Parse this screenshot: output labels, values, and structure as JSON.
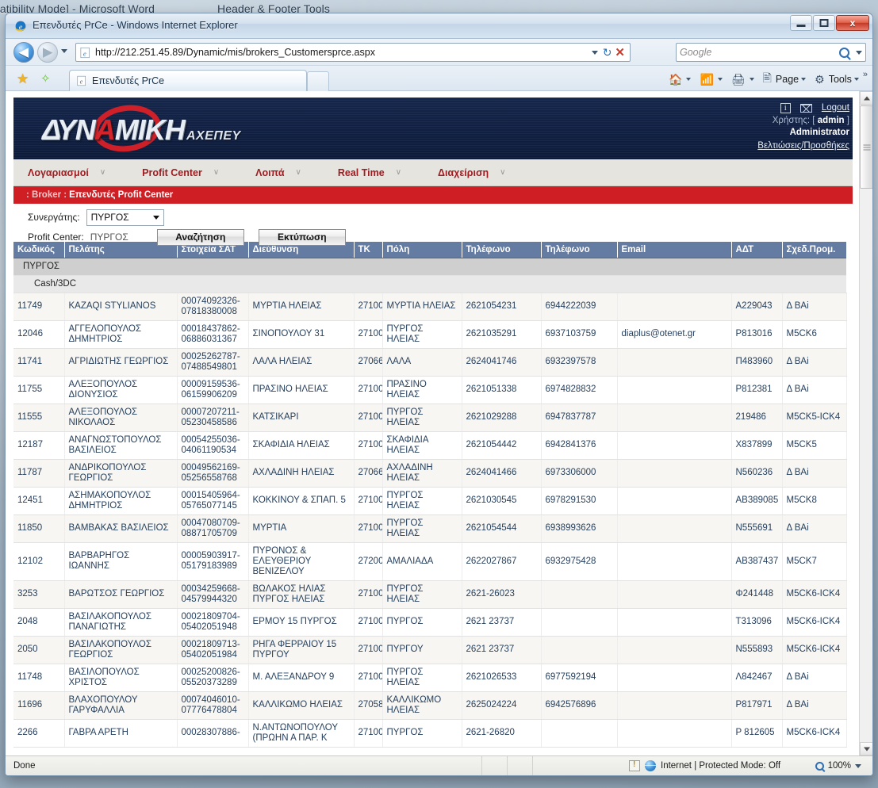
{
  "desktop": {
    "word_title": "patibility Mode] - Microsoft Word",
    "word_tools": "Header & Footer Tools"
  },
  "window": {
    "title": "Επενδυτές PrCe - Windows Internet Explorer",
    "minimize_label": "Minimize",
    "maximize_label": "Maximize",
    "close_label": "x"
  },
  "browser": {
    "back_label": "◀",
    "forward_label": "▶",
    "url": "http://212.251.45.89/Dynamic/mis/brokers_Customersprce.aspx",
    "refresh_label": "↻",
    "stop_label": "✕",
    "search_placeholder": "Google",
    "favorites_label": "Favorites",
    "add_favorite_label": "Add to Favorites",
    "tab_label": "Επενδυτές PrCe",
    "new_tab_label": "",
    "command_home": "Home",
    "command_feeds": "Feeds",
    "command_print": "Print",
    "command_page": "Page",
    "command_tools": "Tools",
    "command_more": "»"
  },
  "site": {
    "logo_main_1": "ΔΥΝ",
    "logo_main_red": "Α",
    "logo_main_2": "ΜΙΚΗ",
    "logo_sub": "ΑΧΕΠΕΥ",
    "info_icon_label": "i",
    "logout_label": "Logout",
    "user_prefix": "Χρήστης: [",
    "user_name": "admin",
    "user_suffix": "]",
    "role": "Administrator",
    "improvements_link": "Βελτιώσεις/Προσθήκες"
  },
  "navmenu": {
    "items": [
      {
        "label": "Λογαριασμοί",
        "caret": "∨"
      },
      {
        "label": "Profit Center",
        "caret": "∨"
      },
      {
        "label": "Λοιπά",
        "caret": "∨"
      },
      {
        "label": "Real Time",
        "caret": "∨"
      },
      {
        "label": "Διαχείριση",
        "caret": "∨"
      }
    ]
  },
  "breadcrumb": {
    "prefix": ": Broker :",
    "current": "Επενδυτές Profit Center"
  },
  "filters": {
    "partner_label": "Συνεργάτης:",
    "partner_value": "ΠΥΡΓΟΣ",
    "profit_center_label": "Profit Center:",
    "profit_center_value": "ΠΥΡΓΟΣ",
    "search_button": "Αναζήτηση",
    "print_button": "Εκτύπωση"
  },
  "table": {
    "columns": [
      "Κωδικός",
      "Πελάτης",
      "Στοιχεία ΣΑΤ",
      "Διεύθυνση",
      "ΤΚ",
      "Πόλη",
      "Τηλέφωνο",
      "Τηλέφωνο",
      "Email",
      "ΑΔΤ",
      "Σχεδ.Προμ."
    ],
    "group_label": "ΠΥΡΓΟΣ",
    "subgroup_label": "Cash/3DC",
    "rows": [
      {
        "code": "11749",
        "customer": "KAZAQI STYLIANOS",
        "sat": "00074092326-\n07818380008",
        "address": "ΜΥΡΤΙΑ ΗΛΕΙΑΣ",
        "tk": "27100",
        "city": "ΜΥΡΤΙΑ ΗΛΕΙΑΣ",
        "phone1": "2621054231",
        "phone2": "6944222039",
        "email": "",
        "adt": "Α229043",
        "plan": "Δ ΒΑi"
      },
      {
        "code": "12046",
        "customer": "ΑΓΓΕΛΟΠΟΥΛΟΣ\nΔΗΜΗΤΡΙΟΣ",
        "sat": "00018437862-\n06886031367",
        "address": "ΣΙΝΟΠΟΥΛΟΥ 31",
        "tk": "27100",
        "city": "ΠΥΡΓΟΣ ΗΛΕΙΑΣ",
        "phone1": "2621035291",
        "phone2": "6937103759",
        "email": "diaplus@otenet.gr",
        "adt": "Ρ813016",
        "plan": "M5CK6"
      },
      {
        "code": "11741",
        "customer": "ΑΓΡΙΔΙΩΤΗΣ ΓΕΩΡΓΙΟΣ",
        "sat": "00025262787-\n07488549801",
        "address": "ΛΑΛΑ ΗΛΕΙΑΣ",
        "tk": "27066",
        "city": "ΛΑΛΑ",
        "phone1": "2624041746",
        "phone2": "6932397578",
        "email": "",
        "adt": "Π483960",
        "plan": "Δ ΒΑi"
      },
      {
        "code": "11755",
        "customer": "ΑΛΕΞΟΠΟΥΛΟΣ\nΔΙΟΝΥΣΙΟΣ",
        "sat": "00009159536-\n06159906209",
        "address": "ΠΡΑΣΙΝΟ ΗΛΕΙΑΣ",
        "tk": "27100",
        "city": "ΠΡΑΣΙΝΟ ΗΛΕΙΑΣ",
        "phone1": "2621051338",
        "phone2": "6974828832",
        "email": "",
        "adt": "Ρ812381",
        "plan": "Δ ΒΑi"
      },
      {
        "code": "11555",
        "customer": "ΑΛΕΞΟΠΟΥΛΟΣ\nΝΙΚΟΛΑΟΣ",
        "sat": "00007207211-\n05230458586",
        "address": "ΚΑΤΣΙΚΑΡΙ",
        "tk": "27100",
        "city": "ΠΥΡΓΟΣ ΗΛΕΙΑΣ",
        "phone1": "2621029288",
        "phone2": "6947837787",
        "email": "",
        "adt": "219486",
        "plan": "M5CK5-ICK4"
      },
      {
        "code": "12187",
        "customer": "ΑΝΑΓΝΩΣΤΟΠΟΥΛΟΣ\nΒΑΣΙΛΕΙΟΣ",
        "sat": "00054255036-\n04061190534",
        "address": "ΣΚΑΦΙΔΙΑ ΗΛΕΙΑΣ",
        "tk": "27100",
        "city": "ΣΚΑΦΙΔΙΑ\nΗΛΕΙΑΣ",
        "phone1": "2621054442",
        "phone2": "6942841376",
        "email": "",
        "adt": "Χ837899",
        "plan": "M5CK5"
      },
      {
        "code": "11787",
        "customer": "ΑΝΔΡΙΚΟΠΟΥΛΟΣ\nΓΕΩΡΓΙΟΣ",
        "sat": "00049562169-\n05256558768",
        "address": "ΑΧΛΑΔΙΝΗ ΗΛΕΙΑΣ",
        "tk": "27066",
        "city": "ΑΧΛΑΔΙΝΗ\nΗΛΕΙΑΣ",
        "phone1": "2624041466",
        "phone2": "6973306000",
        "email": "",
        "adt": "Ν560236",
        "plan": "Δ ΒΑi"
      },
      {
        "code": "12451",
        "customer": "ΑΣΗΜΑΚΟΠΟΥΛΟΣ\nΔΗΜΗΤΡΙΟΣ",
        "sat": "00015405964-\n05765077145",
        "address": "ΚΟΚΚΙΝΟΥ & ΣΠΑΠ. 5",
        "tk": "27100",
        "city": "ΠΥΡΓΟΣ ΗΛΕΙΑΣ",
        "phone1": "2621030545",
        "phone2": "6978291530",
        "email": "",
        "adt": "ΑΒ389085",
        "plan": "M5CK8"
      },
      {
        "code": "11850",
        "customer": "ΒΑΜΒΑΚΑΣ ΒΑΣΙΛΕΙΟΣ",
        "sat": "00047080709-\n08871705709",
        "address": "ΜΥΡΤΙΑ",
        "tk": "27100",
        "city": "ΠΥΡΓΟΣ ΗΛΕΙΑΣ",
        "phone1": "2621054544",
        "phone2": "6938993626",
        "email": "",
        "adt": "Ν555691",
        "plan": "Δ ΒΑi"
      },
      {
        "code": "12102",
        "customer": "ΒΑΡΒΑΡΗΓΟΣ ΙΩΑΝΝΗΣ",
        "sat": "00005903917-\n05179183989",
        "address": "ΠΥΡΟΝΟΣ & ΕΛΕΥΘΕΡΙΟΥ\nΒΕΝΙΖΕΛΟΥ",
        "tk": "27200",
        "city": "ΑΜΑΛΙΑΔΑ",
        "phone1": "2622027867",
        "phone2": "6932975428",
        "email": "",
        "adt": "ΑΒ387437",
        "plan": "M5CK7"
      },
      {
        "code": "3253",
        "customer": "ΒΑΡΩΤΣΟΣ ΓΕΩΡΓΙΟΣ",
        "sat": "00034259668-\n04579944320",
        "address": "ΒΩΛΑΚΟΣ ΗΛΙΑΣ\nΠΥΡΓΟΣ ΗΛΕΙΑΣ",
        "tk": "27100",
        "city": "ΠΥΡΓΟΣ ΗΛΕΙΑΣ",
        "phone1": "2621-26023",
        "phone2": "",
        "email": "",
        "adt": "Φ241448",
        "plan": "M5CK6-ICK4"
      },
      {
        "code": "2048",
        "customer": "ΒΑΣΙΛΑΚΟΠΟΥΛΟΣ\nΠΑΝΑΓΙΩΤΗΣ",
        "sat": "00021809704-\n05402051948",
        "address": "ΕΡΜΟΥ 15 ΠΥΡΓΟΣ",
        "tk": "27100",
        "city": "ΠΥΡΓΟΣ",
        "phone1": "2621 23737",
        "phone2": "",
        "email": "",
        "adt": "Τ313096",
        "plan": "M5CK6-ICK4"
      },
      {
        "code": "2050",
        "customer": "ΒΑΣΙΛΑΚΟΠΟΥΛΟΣ\nΓΕΩΡΓΙΟΣ",
        "sat": "00021809713-\n05402051984",
        "address": "ΡΗΓΑ ΦΕΡΡΑΙΟΥ 15\nΠΥΡΓΟΥ",
        "tk": "27100",
        "city": "ΠΥΡΓΟΥ",
        "phone1": "2621 23737",
        "phone2": "",
        "email": "",
        "adt": "Ν555893",
        "plan": "M5CK6-ICK4"
      },
      {
        "code": "11748",
        "customer": "ΒΑΣΙΛΟΠΟΥΛΟΣ ΧΡΙΣΤΟΣ",
        "sat": "00025200826-\n05520373289",
        "address": "Μ. ΑΛΕΞΑΝΔΡΟΥ 9",
        "tk": "27100",
        "city": "ΠΥΡΓΟΣ ΗΛΕΙΑΣ",
        "phone1": "2621026533",
        "phone2": "6977592194",
        "email": "",
        "adt": "Λ842467",
        "plan": "Δ ΒΑi"
      },
      {
        "code": "11696",
        "customer": "ΒΛΑΧΟΠΟΥΛΟΥ\nΓΑΡΥΦΑΛΛΙΑ",
        "sat": "00074046010-\n07776478804",
        "address": "ΚΑΛΛΙΚΩΜΟ ΗΛΕΙΑΣ",
        "tk": "27058",
        "city": "ΚΑΛΛΙΚΩΜΟ\nΗΛΕΙΑΣ",
        "phone1": "2625024224",
        "phone2": "6942576896",
        "email": "",
        "adt": "Ρ817971",
        "plan": "Δ ΒΑi"
      },
      {
        "code": "2266",
        "customer": "ΓΑΒΡΑ ΑΡΕΤΗ",
        "sat": "00028307886-",
        "address": "Ν.ΑΝΤΩΝΟΠΟΥΛΟΥ\n(ΠΡΩΗΝ Α ΠΑΡ. Κ",
        "tk": "27100",
        "city": "ΠΥΡΓΟΣ",
        "phone1": "2621-26820",
        "phone2": "",
        "email": "",
        "adt": "Ρ 812605",
        "plan": "M5CK6-ICK4"
      }
    ]
  },
  "statusbar": {
    "status_text": "Done",
    "zone_text": "Internet | Protected Mode: Off",
    "zoom_level": "100%"
  }
}
